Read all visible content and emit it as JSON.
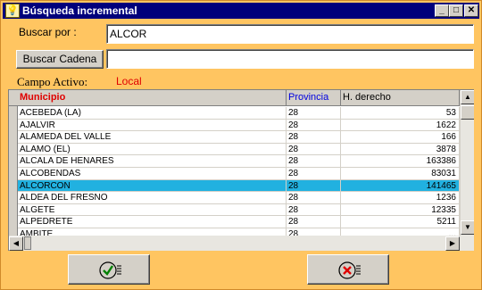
{
  "window": {
    "title": "Búsqueda incremental",
    "icon": "lightbulb-icon",
    "controls": {
      "minimize": "_",
      "maximize": "□",
      "close": "✕"
    }
  },
  "search": {
    "buscar_por_label": "Buscar por :",
    "buscar_por_value": "ALCOR",
    "buscar_cadena_label": "Buscar Cadena",
    "buscar_cadena_value": "",
    "campo_activo_label": "Campo Activo:",
    "campo_activo_value": "Local"
  },
  "grid": {
    "columns": [
      {
        "label": "Municipio",
        "color": "#e00000"
      },
      {
        "label": "Provincia",
        "color": "#0000e0"
      },
      {
        "label": "H. derecho",
        "color": "#000000"
      }
    ],
    "rows": [
      [
        "ACEBEDA (LA)",
        "28",
        "53"
      ],
      [
        "AJALVIR",
        "28",
        "1622"
      ],
      [
        "ALAMEDA DEL VALLE",
        "28",
        "166"
      ],
      [
        "ALAMO (EL)",
        "28",
        "3878"
      ],
      [
        "ALCALA DE HENARES",
        "28",
        "163386"
      ],
      [
        "ALCOBENDAS",
        "28",
        "83031"
      ],
      [
        "ALCORCON",
        "28",
        "141465"
      ],
      [
        "ALDEA DEL FRESNO",
        "28",
        "1236"
      ],
      [
        "ALGETE",
        "28",
        "12335"
      ],
      [
        "ALPEDRETE",
        "28",
        "5211"
      ],
      [
        "AMBITE",
        "28",
        "..."
      ]
    ],
    "selected_index": 6
  },
  "colors": {
    "background": "#ffc561",
    "selected_row": "#21b1e0",
    "title_bar": "#00007b",
    "campo_activo": "#e00000"
  },
  "buttons": {
    "accept_icon": "check-icon",
    "cancel_icon": "x-circle-icon"
  }
}
